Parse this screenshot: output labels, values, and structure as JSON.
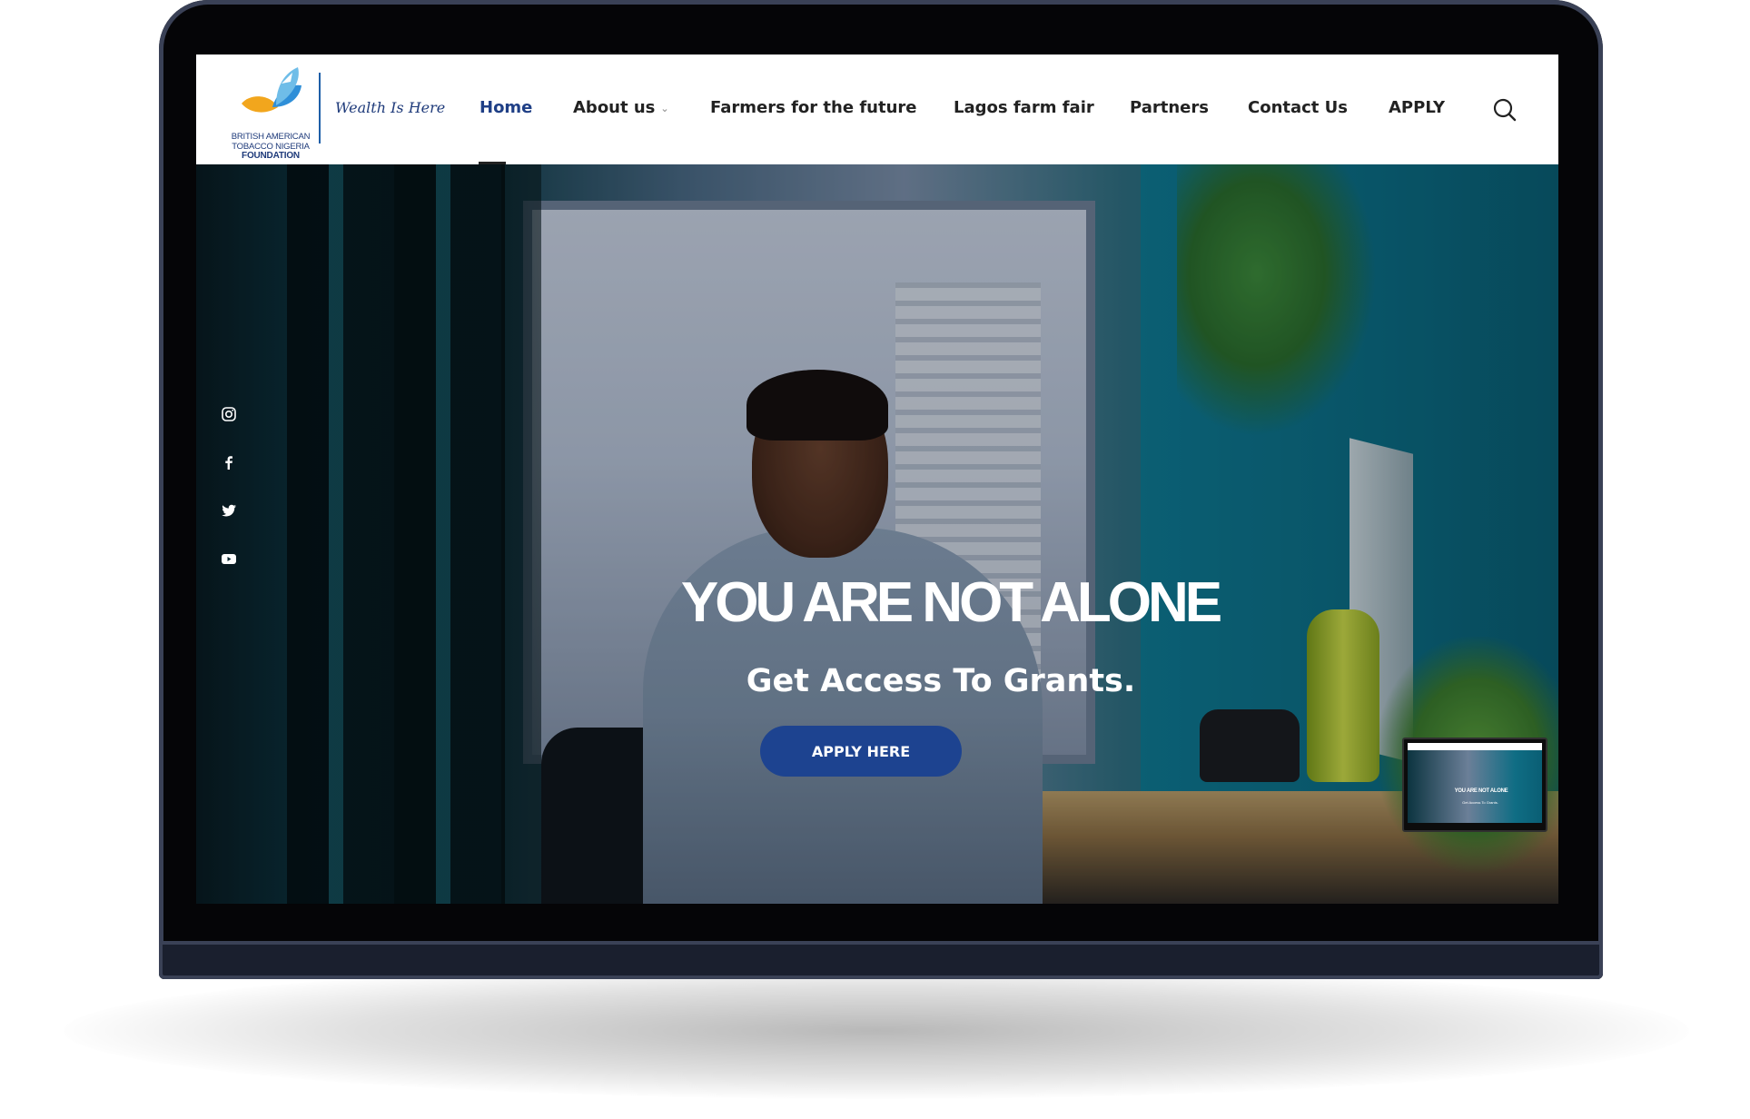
{
  "brand": {
    "logo_lines": [
      "BRITISH AMERICAN",
      "TOBACCO NIGERIA",
      "FOUNDATION"
    ],
    "tagline": "Wealth Is Here",
    "accent": "#1d4390"
  },
  "nav": {
    "items": [
      {
        "label": "Home",
        "active": true
      },
      {
        "label": "About us",
        "has_dropdown": true
      },
      {
        "label": "Farmers for the future"
      },
      {
        "label": "Lagos farm fair"
      },
      {
        "label": "Partners"
      },
      {
        "label": "Contact Us"
      },
      {
        "label": "APPLY"
      }
    ],
    "search_icon": "search-icon"
  },
  "social": {
    "icons": [
      "instagram-icon",
      "facebook-icon",
      "twitter-icon",
      "youtube-icon"
    ]
  },
  "hero": {
    "title": "YOU ARE NOT ALONE",
    "subtitle": "Get Access To Grants.",
    "cta_label": "APPLY HERE"
  },
  "thumbnail": {
    "title": "YOU ARE NOT ALONE",
    "subtitle": "Get Access To Grants."
  }
}
